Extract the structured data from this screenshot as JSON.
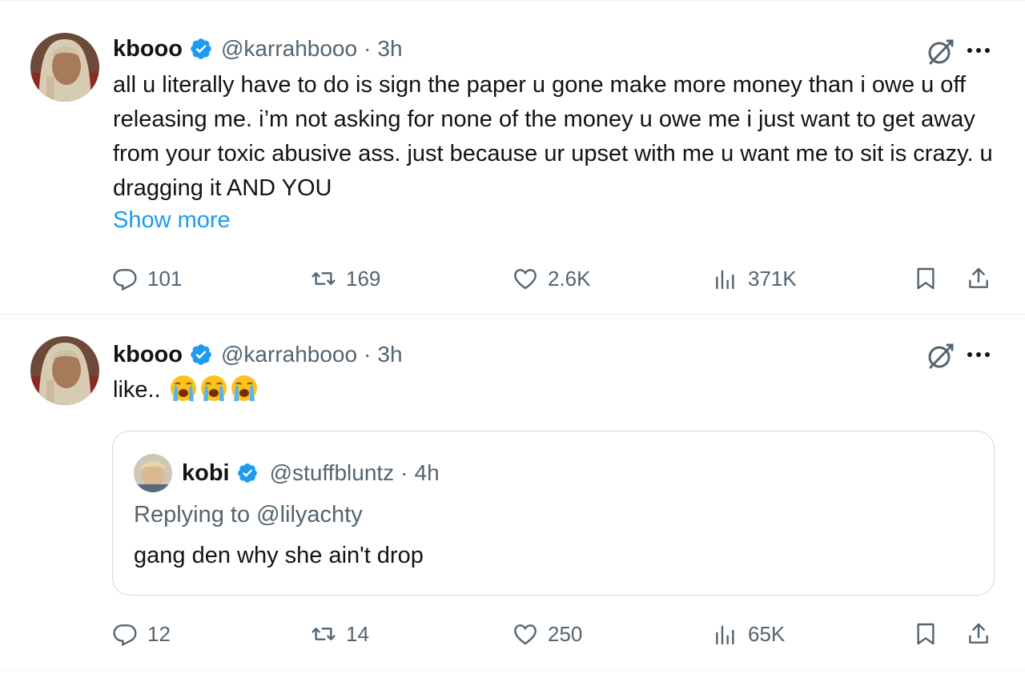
{
  "tweets": [
    {
      "display_name": "kbooo",
      "handle": "@karrahbooo",
      "separator": "·",
      "time": "3h",
      "text": "all u literally have to do is sign the paper u gone make more money than i owe u off releasing me. i’m not asking for none of the money u owe me i just want to get away from your toxic abusive ass. just because ur upset with me u want me to sit is crazy. u dragging it AND YOU",
      "show_more": "Show more",
      "replies": "101",
      "reposts": "169",
      "likes": "2.6K",
      "views": "371K"
    },
    {
      "display_name": "kbooo",
      "handle": "@karrahbooo",
      "separator": "·",
      "time": "3h",
      "text": "like..",
      "emoji": [
        "loudly-crying-face",
        "loudly-crying-face",
        "loudly-crying-face"
      ],
      "quoted": {
        "display_name": "kobi",
        "handle": "@stuffbluntz",
        "separator": "·",
        "time": "4h",
        "replying_to": "Replying to @lilyachty",
        "text": "gang den why she ain't drop"
      },
      "replies": "12",
      "reposts": "14",
      "likes": "250",
      "views": "65K"
    }
  ],
  "colors": {
    "text": "#0f1419",
    "secondary": "#536471",
    "link": "#1d9bf0",
    "verified": "#1d9bf0",
    "border": "#cfd9de"
  },
  "icons": [
    "verified-badge-icon",
    "grok-icon",
    "more-icon",
    "reply-icon",
    "repost-icon",
    "like-icon",
    "views-icon",
    "bookmark-icon",
    "share-icon"
  ]
}
